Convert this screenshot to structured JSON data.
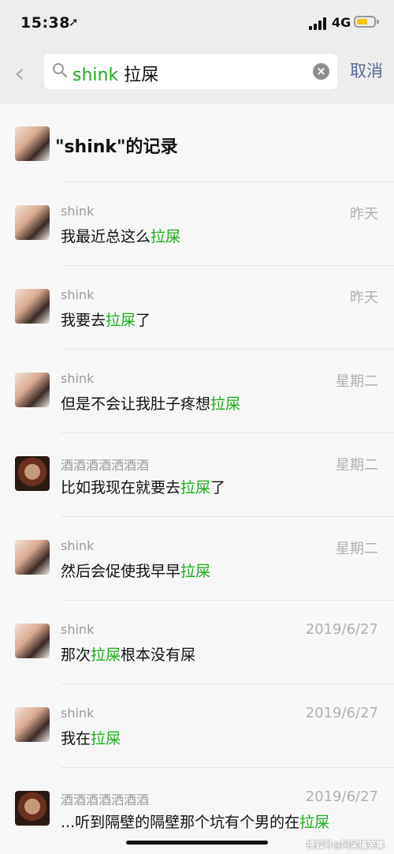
{
  "status": {
    "time": "15:38",
    "network": "4G"
  },
  "search": {
    "query_keyword": "shink",
    "query_term": "拉屎",
    "cancel_label": "取消"
  },
  "header": {
    "title": "\"shink\"的记录"
  },
  "results": [
    {
      "name": "shink",
      "date": "昨天",
      "pre": "我最近总这么",
      "hit": "拉屎",
      "post": "",
      "avatar": "a"
    },
    {
      "name": "shink",
      "date": "昨天",
      "pre": "我要去",
      "hit": "拉屎",
      "post": "了",
      "avatar": "a"
    },
    {
      "name": "shink",
      "date": "星期二",
      "pre": "但是不会让我肚子疼想",
      "hit": "拉屎",
      "post": "",
      "avatar": "a"
    },
    {
      "name": "酒酒酒酒洒酒酒",
      "date": "星期二",
      "pre": "比如我现在就要去",
      "hit": "拉屎",
      "post": "了",
      "avatar": "b"
    },
    {
      "name": "shink",
      "date": "星期二",
      "pre": "然后会促使我早早",
      "hit": "拉屎",
      "post": "",
      "avatar": "a"
    },
    {
      "name": "shink",
      "date": "2019/6/27",
      "pre": "那次",
      "hit": "拉屎",
      "post": "根本没有屎",
      "avatar": "a"
    },
    {
      "name": "shink",
      "date": "2019/6/27",
      "pre": "我在",
      "hit": "拉屎",
      "post": "",
      "avatar": "a"
    },
    {
      "name": "酒酒酒酒洒酒酒",
      "date": "2019/6/27",
      "pre": "...听到隔壁的隔壁那个坑有个男的在",
      "hit": "拉屎",
      "post": "",
      "avatar": "b"
    }
  ],
  "watermark": "搜狐号@阿呆搞笑集"
}
